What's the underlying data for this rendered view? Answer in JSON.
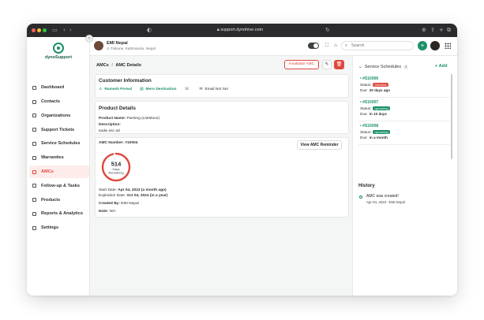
{
  "browser": {
    "url": "support.dynohive.com"
  },
  "user": {
    "name": "EMI Nepal",
    "location": "Tinkune, Kathmandu, Nepal"
  },
  "search": {
    "placeholder": "Search"
  },
  "logo": {
    "text": "dynoSupport"
  },
  "sidebar": {
    "items": [
      {
        "label": "Dashboard",
        "icon": "grid-icon"
      },
      {
        "label": "Contacts",
        "icon": "contacts-icon"
      },
      {
        "label": "Organizations",
        "icon": "building-icon"
      },
      {
        "label": "Support Tickets",
        "icon": "ticket-icon"
      },
      {
        "label": "Service Schedules",
        "icon": "calendar-icon"
      },
      {
        "label": "Warranties",
        "icon": "shield-icon"
      },
      {
        "label": "AMCs",
        "icon": "document-icon",
        "active": true
      },
      {
        "label": "Follow-up & Tasks",
        "icon": "clock-icon"
      },
      {
        "label": "Products",
        "icon": "box-icon"
      },
      {
        "label": "Reports & Analytics",
        "icon": "chart-icon"
      },
      {
        "label": "Settings",
        "icon": "gear-icon"
      }
    ]
  },
  "header": {
    "breadcrumb_parent": "AMCs",
    "breadcrumb_sep": "/",
    "breadcrumb_current": "AMC Details",
    "invalidate_label": "Invalidate AMC"
  },
  "customer": {
    "title": "Customer Information",
    "name": "Ramesh Poreal",
    "organization": "Mero Destination",
    "phone": "",
    "email": "Email Not Set"
  },
  "product": {
    "title": "Product Details",
    "name_label": "Product Name:",
    "name_value": "Painting (LiteMono)",
    "desc_label": "Description:",
    "desc_value": "sadw asc ad"
  },
  "amc": {
    "number_label": "AMC Number:",
    "number_value": "#10004",
    "view_reminder_label": "View AMC Reminder",
    "days_remaining": "514",
    "days_label": "Days",
    "remaining_label": "Remaining",
    "remaining_fraction": 0.96,
    "start_label": "Start Date:",
    "start_value": "Apr 04, 2023 (a month ago)",
    "expiry_label": "Expiration Date:",
    "expiry_value": "Oct 04, 2024 (in a year)",
    "created_label": "Created By:",
    "created_value": "EMI Nepal",
    "note_label": "Note:",
    "note_value": "N/A"
  },
  "schedules": {
    "title": "Service Schedules",
    "count": "4",
    "add_label": "+ Add",
    "items": [
      {
        "id": "#S10006",
        "status_label": "Status:",
        "status": "Overdue",
        "status_type": "over",
        "due_label": "Due:",
        "due": "20 days ago"
      },
      {
        "id": "#S10007",
        "status_label": "Status:",
        "status": "upcoming",
        "status_type": "up",
        "due_label": "Due:",
        "due": "in 10 days"
      },
      {
        "id": "#S10008",
        "status_label": "Status:",
        "status": "upcoming",
        "status_type": "up",
        "due_label": "Due:",
        "due": "in a month"
      }
    ]
  },
  "history": {
    "title": "History",
    "entry_text": "AMC was created!",
    "entry_date": "Apr 04, 2023",
    "entry_author": "EMI Nepal"
  },
  "colors": {
    "brand": "#1c8f6a",
    "danger": "#e0483e",
    "active_bg": "#fdecea"
  }
}
